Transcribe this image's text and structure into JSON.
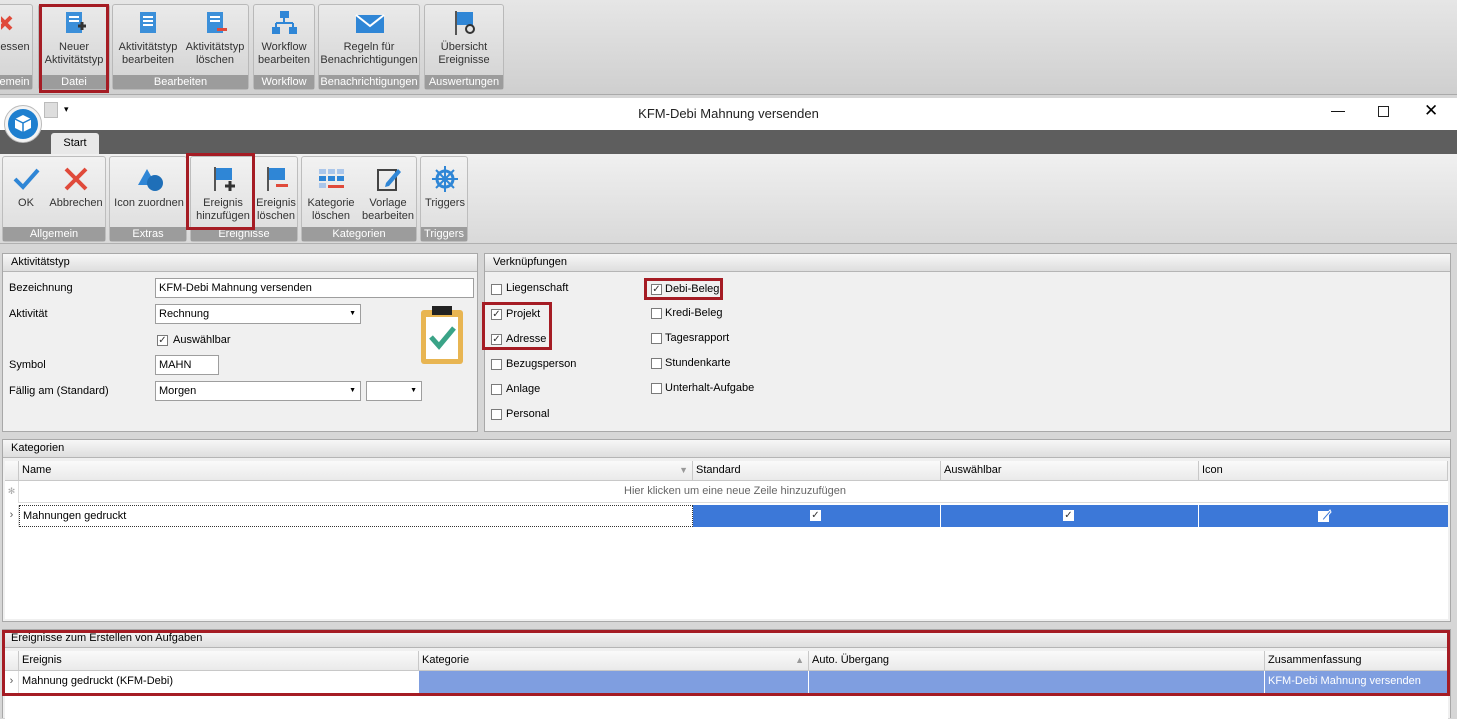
{
  "top_ribbon": {
    "groups": [
      {
        "label": "emein",
        "buttons": [
          {
            "label": "essen",
            "icon": "close-x-icon"
          }
        ]
      },
      {
        "label": "Datei",
        "buttons": [
          {
            "label": "Neuer\nAktivitätstyp",
            "icon": "new-document-icon"
          }
        ]
      },
      {
        "label": "Bearbeiten",
        "buttons": [
          {
            "label": "Aktivitätstyp\nbearbeiten",
            "icon": "edit-document-icon"
          },
          {
            "label": "Aktivitätstyp\nlöschen",
            "icon": "delete-document-icon"
          }
        ]
      },
      {
        "label": "Workflow",
        "buttons": [
          {
            "label": "Workflow\nbearbeiten",
            "icon": "workflow-icon"
          }
        ]
      },
      {
        "label": "Benachrichtigungen",
        "buttons": [
          {
            "label": "Regeln für\nBenachrichtigungen",
            "icon": "mail-icon"
          }
        ]
      },
      {
        "label": "Auswertungen",
        "buttons": [
          {
            "label": "Übersicht\nEreignisse",
            "icon": "flag-search-icon"
          }
        ]
      }
    ]
  },
  "window": {
    "title": "KFM-Debi Mahnung versenden",
    "tab": "Start"
  },
  "inner_ribbon": {
    "groups": [
      {
        "label": "Allgemein",
        "buttons": [
          {
            "label": "OK",
            "icon": "check-icon"
          },
          {
            "label": "Abbrechen",
            "icon": "cancel-x-icon"
          }
        ]
      },
      {
        "label": "Extras",
        "buttons": [
          {
            "label": "Icon zuordnen",
            "icon": "shapes-icon"
          }
        ]
      },
      {
        "label": "Ereignisse",
        "buttons": [
          {
            "label": "Ereignis\nhinzufügen",
            "icon": "flag-add-icon"
          },
          {
            "label": "Ereignis\nlöschen",
            "icon": "flag-remove-icon"
          }
        ]
      },
      {
        "label": "Kategorien",
        "buttons": [
          {
            "label": "Kategorie\nlöschen",
            "icon": "grid-remove-icon"
          },
          {
            "label": "Vorlage\nbearbeiten",
            "icon": "template-edit-icon"
          }
        ]
      },
      {
        "label": "Triggers",
        "buttons": [
          {
            "label": "Triggers",
            "icon": "helm-icon"
          }
        ]
      }
    ]
  },
  "aktivitaetstyp": {
    "title": "Aktivitätstyp",
    "bezeichnung_label": "Bezeichnung",
    "bezeichnung_value": "KFM-Debi Mahnung versenden",
    "aktivitaet_label": "Aktivität",
    "aktivitaet_value": "Rechnung",
    "auswaehlbar_label": "Auswählbar",
    "auswaehlbar_checked": true,
    "symbol_label": "Symbol",
    "symbol_value": "MAHN",
    "faellig_label": "Fällig am (Standard)",
    "faellig_value": "Morgen",
    "faellig_value2": ""
  },
  "verknuepfungen": {
    "title": "Verknüpfungen",
    "col1": [
      {
        "label": "Liegenschaft",
        "checked": false
      },
      {
        "label": "Projekt",
        "checked": true
      },
      {
        "label": "Adresse",
        "checked": true
      },
      {
        "label": "Bezugsperson",
        "checked": false
      },
      {
        "label": "Anlage",
        "checked": false
      },
      {
        "label": "Personal",
        "checked": false
      }
    ],
    "col2": [
      {
        "label": "Debi-Beleg",
        "checked": true
      },
      {
        "label": "Kredi-Beleg",
        "checked": false
      },
      {
        "label": "Tagesrapport",
        "checked": false
      },
      {
        "label": "Stundenkarte",
        "checked": false
      },
      {
        "label": "Unterhalt-Aufgabe",
        "checked": false
      }
    ]
  },
  "kategorien": {
    "title": "Kategorien",
    "columns": [
      "Name",
      "Standard",
      "Auswählbar",
      "Icon"
    ],
    "new_row_hint": "Hier klicken um eine neue Zeile hinzuzufügen",
    "rows": [
      {
        "name": "Mahnungen gedruckt",
        "standard": true,
        "auswaehlbar": true,
        "icon": "edit-icon"
      }
    ]
  },
  "ereignisse": {
    "title": "Ereignisse zum Erstellen von Aufgaben",
    "columns": [
      "Ereignis",
      "Kategorie",
      "Auto. Übergang",
      "Zusammenfassung"
    ],
    "rows": [
      {
        "ereignis": "Mahnung gedruckt (KFM-Debi)",
        "kategorie": "",
        "auto": "",
        "zusammenfassung": "KFM-Debi Mahnung versenden"
      }
    ]
  },
  "colors": {
    "highlight": "#a51c24",
    "selection": "#3c78d8",
    "selection_light": "#7f9ee0",
    "icon_blue": "#2f86d6"
  }
}
